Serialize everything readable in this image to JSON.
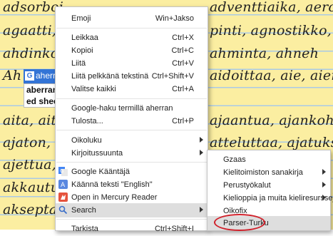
{
  "background_text": {
    "lines": [
      "adsorboi",
      "agaatti,",
      "ahdinko",
      "Ah",
      "",
      "aita, ait",
      "ajaton, a",
      "ajettua, a",
      "akkautu",
      "akseptar"
    ],
    "right_lines": [
      "adventtiaika, aerobi",
      "pinti, agnostikko, ahd",
      "ahminta, ahneh",
      "aidoittaa, aie, aiempi,",
      "",
      "ajaantua, ajankohta",
      "atteluttaa, ajatuksela",
      "",
      "",
      ""
    ],
    "selected_word": "aherran",
    "spell_suggestions": [
      "aberrant",
      "ed shee"
    ]
  },
  "context_menu": {
    "items": [
      {
        "label": "Emoji",
        "shortcut": "Win+Jakso"
      },
      {
        "label": "Leikkaa",
        "shortcut": "Ctrl+X"
      },
      {
        "label": "Kopioi",
        "shortcut": "Ctrl+C"
      },
      {
        "label": "Liitä",
        "shortcut": "Ctrl+V"
      },
      {
        "label": "Liitä pelkkänä tekstinä",
        "shortcut": "Ctrl+Shift+V"
      },
      {
        "label": "Valitse kaikki",
        "shortcut": "Ctrl+A"
      },
      {
        "label": "Google-haku termillä aherran",
        "shortcut": ""
      },
      {
        "label": "Tulosta...",
        "shortcut": "Ctrl+P"
      },
      {
        "label": "Oikoluku",
        "shortcut": ""
      },
      {
        "label": "Kirjoitussuunta",
        "shortcut": ""
      },
      {
        "label": "Google Kääntäjä",
        "shortcut": ""
      },
      {
        "label": "Käännä teksti \"English\"",
        "shortcut": ""
      },
      {
        "label": "Open in Mercury Reader",
        "shortcut": ""
      },
      {
        "label": "Search",
        "shortcut": ""
      },
      {
        "label": "Tarkista",
        "shortcut": "Ctrl+Shift+I"
      }
    ]
  },
  "submenu": {
    "items": [
      {
        "label": "Gzaas"
      },
      {
        "label": "Kielitoimiston sanakirja"
      },
      {
        "label": "Perustyökalut"
      },
      {
        "label": "Kielioppia ja muita kieliresursseja"
      },
      {
        "label": "Oikofix"
      },
      {
        "label": "Parser-Turku"
      }
    ]
  },
  "colors": {
    "background": "#fbeea1",
    "ruling": "#a9c9e6",
    "selection": "#3374d6",
    "highlight": "#dedede",
    "annotation_circle": "#d0202a"
  }
}
